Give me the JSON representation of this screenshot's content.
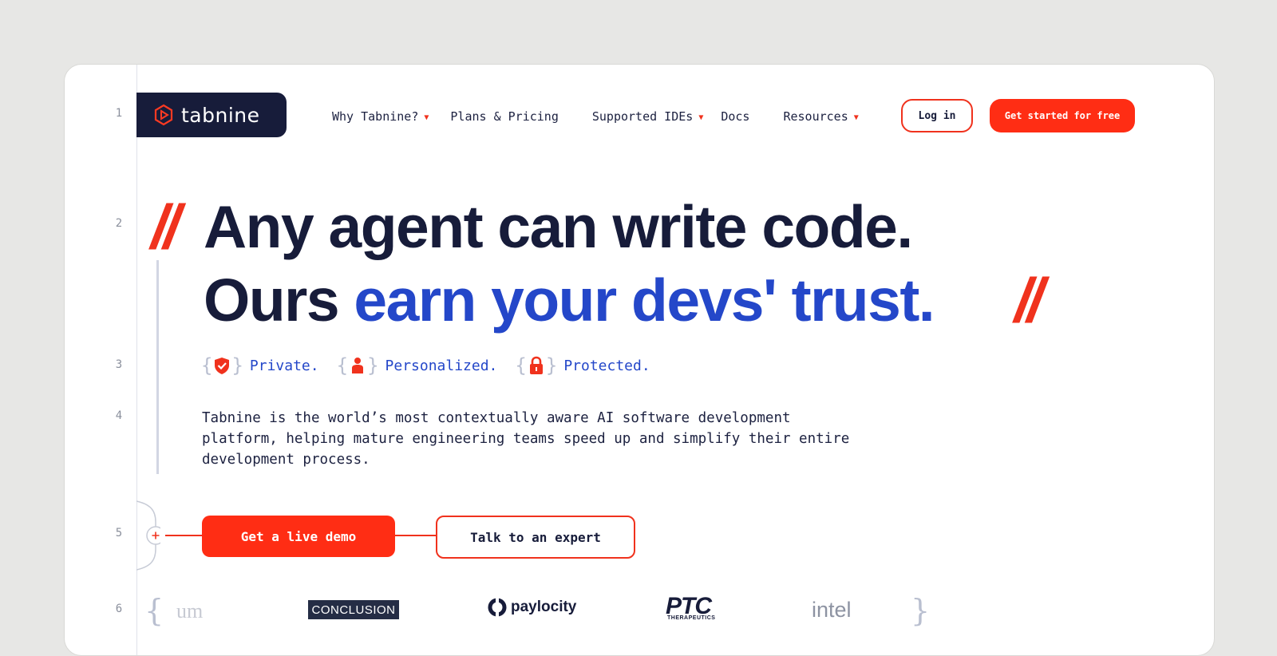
{
  "line_numbers": [
    "1",
    "2",
    "3",
    "4",
    "5",
    "6"
  ],
  "brand": {
    "name": "tabnine",
    "icon": "hexagon-play-icon"
  },
  "nav": {
    "items": [
      {
        "label": "Why Tabnine?",
        "dropdown": true
      },
      {
        "label": "Plans & Pricing",
        "dropdown": false
      },
      {
        "label": "Supported IDEs",
        "dropdown": true
      },
      {
        "label": "Docs",
        "dropdown": false
      },
      {
        "label": "Resources",
        "dropdown": true
      }
    ],
    "login": "Log in",
    "cta": "Get started for free"
  },
  "hero": {
    "slash_open": "//",
    "line1": "Any agent can write code.",
    "line2_prefix": "Ours ",
    "line2_accent": "earn your devs' trust.",
    "slash_close": "//"
  },
  "pillars": [
    {
      "label": "Private.",
      "icon": "shield-check-icon"
    },
    {
      "label": "Personalized.",
      "icon": "person-icon"
    },
    {
      "label": "Protected.",
      "icon": "lock-icon"
    }
  ],
  "description": "Tabnine is the world’s most contextually aware AI software development platform, helping mature engineering teams speed up and simplify their entire development process.",
  "cta": {
    "primary": "Get a live demo",
    "secondary": "Talk to an expert"
  },
  "customer_logos": [
    "um",
    "CONCLUSION",
    "paylocity",
    "PTC",
    "THERAPEUTICS",
    "intel"
  ],
  "colors": {
    "accent_red": "#ff2d14",
    "accent_blue": "#2447c9",
    "navy": "#171c3a",
    "background": "#e7e7e5"
  }
}
